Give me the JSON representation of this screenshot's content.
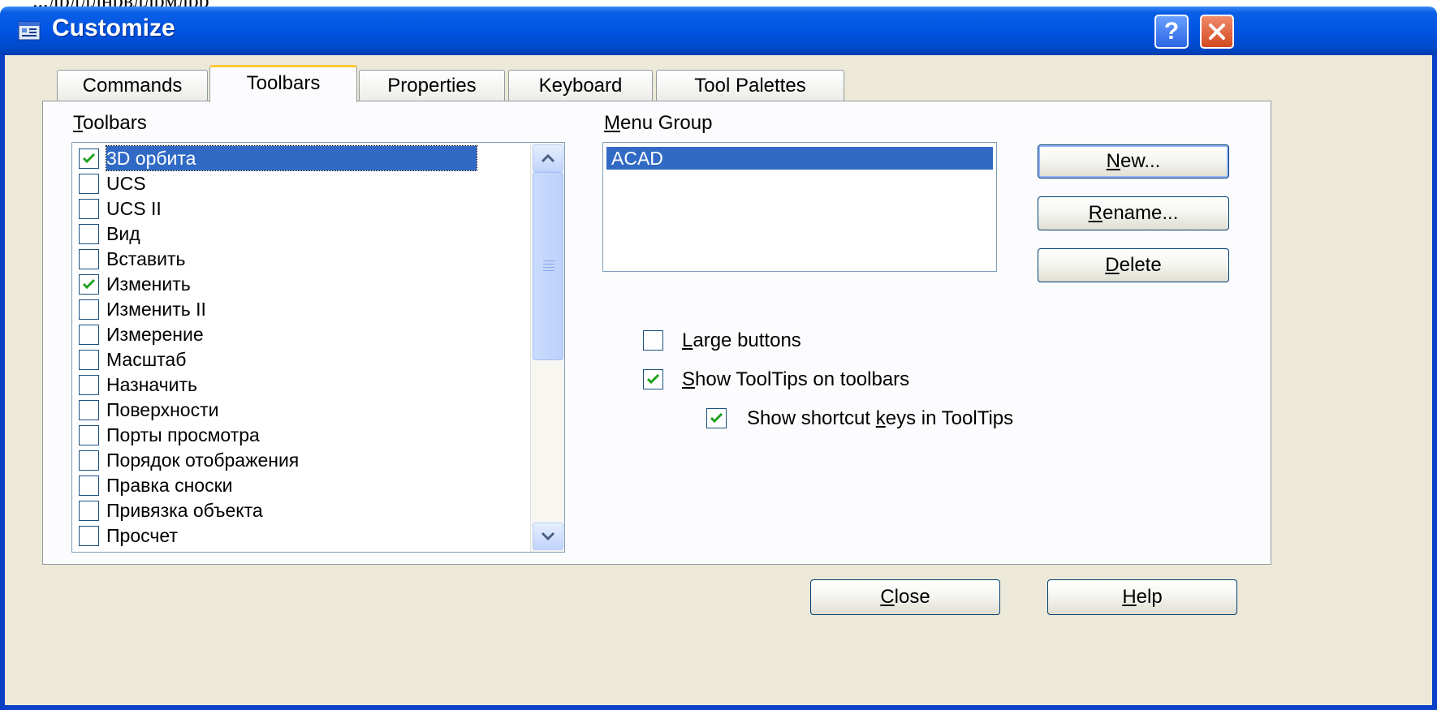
{
  "dialog": {
    "title": "Customize",
    "help_glyph": "?",
    "top_strip_text": "...дрддлнрвллрмлрр"
  },
  "tabs": [
    {
      "label": "Commands"
    },
    {
      "label": "Toolbars",
      "active": true
    },
    {
      "label": "Properties"
    },
    {
      "label": "Keyboard"
    },
    {
      "label": "Tool Palettes"
    }
  ],
  "toolbars_panel": {
    "label_mnemonic": "T",
    "label_rest": "oolbars",
    "items": [
      {
        "label": "3D орбита",
        "checked": true,
        "selected": true
      },
      {
        "label": "UCS",
        "checked": false
      },
      {
        "label": "UCS II",
        "checked": false
      },
      {
        "label": "Вид",
        "checked": false
      },
      {
        "label": "Вставить",
        "checked": false
      },
      {
        "label": "Изменить",
        "checked": true
      },
      {
        "label": "Изменить II",
        "checked": false
      },
      {
        "label": "Измерение",
        "checked": false
      },
      {
        "label": "Масштаб",
        "checked": false
      },
      {
        "label": "Назначить",
        "checked": false
      },
      {
        "label": "Поверхности",
        "checked": false
      },
      {
        "label": "Порты просмотра",
        "checked": false
      },
      {
        "label": "Порядок отображения",
        "checked": false
      },
      {
        "label": "Правка сноски",
        "checked": false
      },
      {
        "label": "Привязка объекта",
        "checked": false
      },
      {
        "label": "Просчет",
        "checked": false
      }
    ]
  },
  "menu_group": {
    "label_mnemonic": "M",
    "label_rest": "enu Group",
    "items": [
      {
        "label": "ACAD",
        "selected": true
      }
    ]
  },
  "buttons": {
    "new": {
      "mnemonic": "N",
      "rest": "ew..."
    },
    "rename": {
      "mnemonic": "R",
      "rest": "ename..."
    },
    "delete": {
      "mnemonic": "D",
      "rest": "elete"
    },
    "close": {
      "mnemonic": "C",
      "rest": "lose"
    },
    "help": {
      "mnemonic": "H",
      "rest": "elp"
    }
  },
  "options": {
    "large_buttons": {
      "mnemonic": "L",
      "rest": "arge buttons",
      "checked": false
    },
    "show_tooltips": {
      "mnemonic": "S",
      "rest": "how ToolTips on toolbars",
      "checked": true
    },
    "show_shortcut": {
      "pre": "Show shortcut ",
      "mnemonic": "k",
      "post": "eys in ToolTips",
      "checked": true
    }
  },
  "colors": {
    "titlebar": "#0054e3",
    "dialog_bg": "#ececd8",
    "selection": "#316ac5",
    "check": "#21a121",
    "tab_accent": "#ffc83c"
  },
  "icons": {
    "title": "customize-icon",
    "help": "help-icon",
    "close": "close-icon",
    "scroll_up": "chevron-up-icon",
    "scroll_down": "chevron-down-icon",
    "check": "checkmark-icon"
  }
}
